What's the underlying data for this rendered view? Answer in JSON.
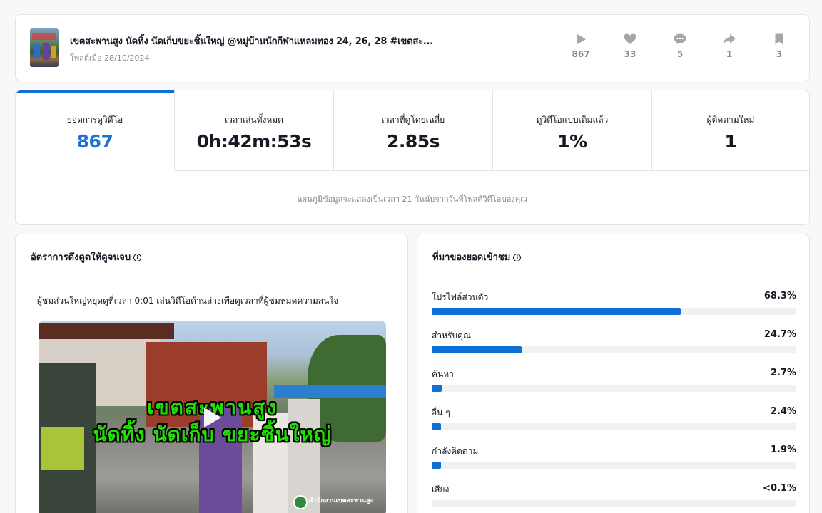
{
  "post": {
    "title": "เขตสะพานสูง นัดทิ้ง นัดเก็บขยะชิ้นใหญ่ @หมู่บ้านนักกีฬาแหลมทอง 24, 26, 28 #เขตสะ...",
    "date": "โพสต์เมื่อ 28/10/2024",
    "stats": {
      "views": "867",
      "likes": "33",
      "comments": "5",
      "shares": "1",
      "saves": "3"
    }
  },
  "metrics": {
    "tabs": [
      {
        "label": "ยอดการดูวิดีโอ",
        "value": "867"
      },
      {
        "label": "เวลาเล่นทั้งหมด",
        "value": "0h:42m:53s"
      },
      {
        "label": "เวลาที่ดูโดยเฉลี่ย",
        "value": "2.85s"
      },
      {
        "label": "ดูวิดีโอแบบเต็มแล้ว",
        "value": "1%"
      },
      {
        "label": "ผู้ติดตามใหม่",
        "value": "1"
      }
    ],
    "note": "แผนภูมิข้อมูลจะแสดงเป็นเวลา 21 วันนับจากวันที่โพสต์วิดีโอของคุณ"
  },
  "retention": {
    "title": "อัตราการดึงดูดให้ดูจนจบ",
    "description": "ผู้ชมส่วนใหญ่หยุดดูที่เวลา 0:01 เล่นวิดีโอด้านล่างเพื่อดูเวลาที่ผู้ชมหมดความสนใจ",
    "video_text_line1": "เขตสะพานสูง",
    "video_text_line2": "นัดทิ้ง นัดเก็บ ขยะชิ้นใหญ่",
    "video_logo": "สำนักงานเขตสะพานสูง"
  },
  "sources": {
    "title": "ที่มาของยอดเข้าชม",
    "items": [
      {
        "label": "โปรไฟล์ส่วนตัว",
        "pct": "68.3%",
        "fraction": 0.683
      },
      {
        "label": "สำหรับคุณ",
        "pct": "24.7%",
        "fraction": 0.247
      },
      {
        "label": "ค้นหา",
        "pct": "2.7%",
        "fraction": 0.027
      },
      {
        "label": "อื่น ๆ",
        "pct": "2.4%",
        "fraction": 0.024
      },
      {
        "label": "กำลังติดตาม",
        "pct": "1.9%",
        "fraction": 0.019
      },
      {
        "label": "เสียง",
        "pct": "<0.1%",
        "fraction": 0.0
      }
    ]
  },
  "colors": {
    "accent": "#0e6fd6",
    "active_value": "#1c73d4",
    "icon_gray": "#a5a6aa"
  }
}
